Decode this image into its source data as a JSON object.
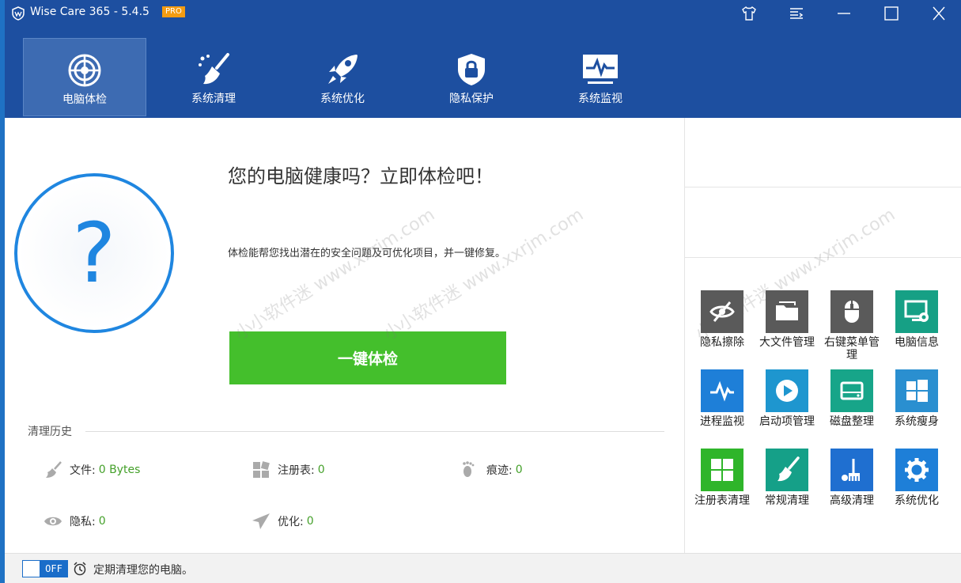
{
  "window": {
    "title": "Wise Care 365 - 5.4.5",
    "badge": "PRO"
  },
  "nav": {
    "tabs": [
      {
        "label": "电脑体检",
        "icon": "radar-icon",
        "active": true
      },
      {
        "label": "系统清理",
        "icon": "broom-icon",
        "active": false
      },
      {
        "label": "系统优化",
        "icon": "rocket-icon",
        "active": false
      },
      {
        "label": "隐私保护",
        "icon": "shield-lock-icon",
        "active": false
      },
      {
        "label": "系统监视",
        "icon": "monitor-pulse-icon",
        "active": false
      }
    ]
  },
  "main": {
    "status_symbol": "?",
    "headline": "您的电脑健康吗？立即体检吧！",
    "subtext": "体检能帮您找出潜在的安全问题及可优化项目，并一键修复。",
    "scan_button": "一键体检",
    "history": {
      "title": "清理历史",
      "stats": [
        {
          "label": "文件:",
          "value": "0 Bytes",
          "icon": "broom-icon"
        },
        {
          "label": "注册表:",
          "value": "0",
          "icon": "registry-icon"
        },
        {
          "label": "痕迹:",
          "value": "0",
          "icon": "footprint-icon"
        },
        {
          "label": "隐私:",
          "value": "0",
          "icon": "eye-icon"
        },
        {
          "label": "优化:",
          "value": "0",
          "icon": "paper-plane-icon"
        }
      ]
    }
  },
  "tools": [
    {
      "label": "隐私擦除",
      "icon": "privacy-eraser-icon",
      "color": "#5a5a5a"
    },
    {
      "label": "大文件管理",
      "icon": "folder-icon",
      "color": "#5a5a5a"
    },
    {
      "label": "右键菜单管理",
      "icon": "mouse-icon",
      "color": "#5a5a5a"
    },
    {
      "label": "电脑信息",
      "icon": "computer-info-icon",
      "color": "#16a085"
    },
    {
      "label": "进程监视",
      "icon": "pulse-icon",
      "color": "#1e7fd8"
    },
    {
      "label": "启动项管理",
      "icon": "play-icon",
      "color": "#1e96cf"
    },
    {
      "label": "磁盘整理",
      "icon": "disk-icon",
      "color": "#17a589"
    },
    {
      "label": "系统瘦身",
      "icon": "windows-icon",
      "color": "#2a8fd0"
    },
    {
      "label": "注册表清理",
      "icon": "grid-icon",
      "color": "#2fb52a"
    },
    {
      "label": "常规清理",
      "icon": "broom-icon",
      "color": "#15a088"
    },
    {
      "label": "高级清理",
      "icon": "advanced-clean-icon",
      "color": "#1f6fd0"
    },
    {
      "label": "系统优化",
      "icon": "gear-icon",
      "color": "#1e7fd8"
    }
  ],
  "footer": {
    "toggle_state": "OFF",
    "schedule_text": "定期清理您的电脑。"
  },
  "watermark": "小小软件迷 www.xxrjm.com",
  "colors": {
    "header_bg": "#1d4fa0",
    "accent_blue": "#1f86e0",
    "scan_green": "#44bf2c"
  }
}
